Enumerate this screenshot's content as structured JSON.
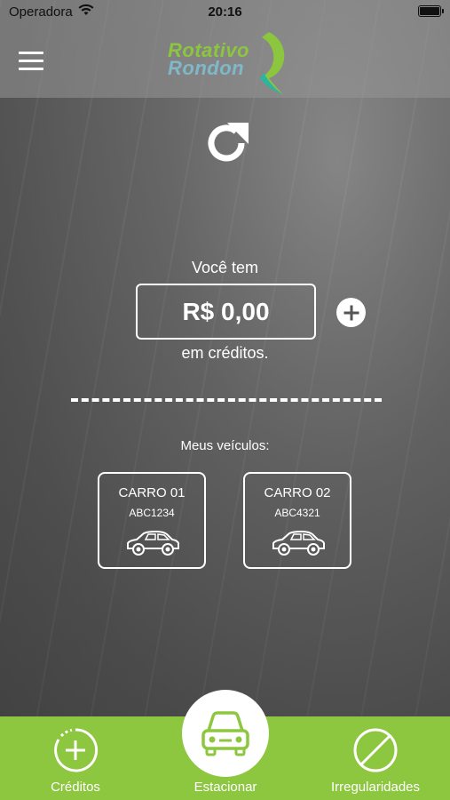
{
  "status_bar": {
    "carrier": "Operadora",
    "time": "20:16"
  },
  "header": {
    "logo_line1": "Rotativo",
    "logo_line2": "Rondon"
  },
  "credits": {
    "intro": "Você tem",
    "amount": "R$ 0,00",
    "outro": "em créditos."
  },
  "vehicles": {
    "label": "Meus veículos:",
    "items": [
      {
        "name": "CARRO 01",
        "plate": "ABC1234"
      },
      {
        "name": "CARRO 02",
        "plate": "ABC4321"
      }
    ]
  },
  "bottom_nav": {
    "creditos": "Créditos",
    "estacionar": "Estacionar",
    "irregularidades": "Irregularidades"
  },
  "colors": {
    "accent": "#8dc63f",
    "logo_secondary": "#7fb8c9"
  },
  "icons": [
    "menu-icon",
    "refresh-icon",
    "add-icon",
    "car-icon",
    "add-circle-icon",
    "prohibited-icon"
  ]
}
